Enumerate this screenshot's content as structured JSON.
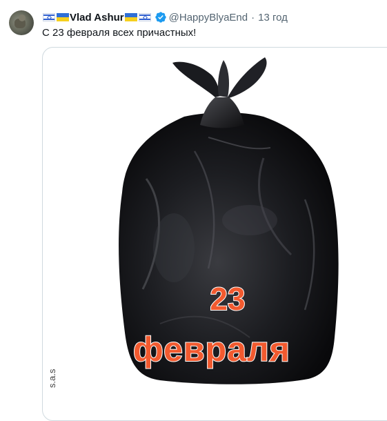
{
  "tweet": {
    "author_name": "Vlad Ashur",
    "handle": "@HappyBlyaEnd",
    "separator": "·",
    "time": "13 год",
    "text": "С 23 февраля всех причастных!",
    "verified": true
  },
  "media": {
    "caption_number": "23",
    "caption_word": "февраля",
    "signature": "s.a.s"
  },
  "icons": {
    "flag_left": "israel-flag-icon",
    "flag_mid": "ukraine-flag-icon",
    "flag_mid2": "ukraine-flag-icon",
    "flag_right": "israel-flag-icon",
    "verified": "verified-badge-icon"
  },
  "colors": {
    "accent": "#1d9bf0",
    "caption": "#f25a2f",
    "secondary_text": "#536471"
  }
}
